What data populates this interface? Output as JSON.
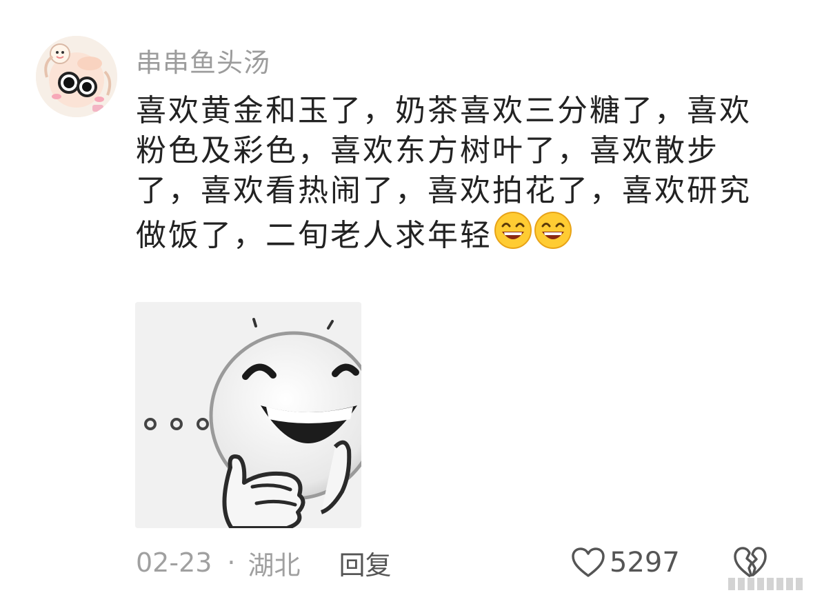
{
  "comment": {
    "username": "串串鱼头汤",
    "text": "喜欢黄金和玉了，奶茶喜欢三分糖了，喜欢粉色及彩色，喜欢东方树叶了，喜欢散步了，喜欢看热闹了，喜欢拍花了，喜欢研究做饭了，二旬老人求年轻",
    "trailing_emojis": [
      "grin-emoji",
      "grin-emoji"
    ],
    "sticker": "laughing-face-sticker",
    "date": "02-23",
    "separator": "·",
    "location": "湖北",
    "reply_label": "回复",
    "like_count": "5297"
  },
  "icons": {
    "like": "heart-outline-icon",
    "dislike": "broken-heart-icon"
  },
  "colors": {
    "username": "#9c9c9c",
    "text": "#222222",
    "meta": "#a0a0a0",
    "emoji_face": "#ffcc33"
  }
}
